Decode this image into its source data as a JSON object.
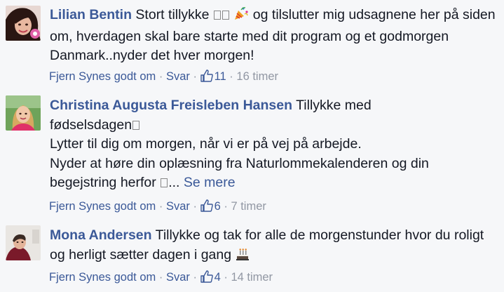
{
  "comments": [
    {
      "author": "Lilian Bentin",
      "text": "Stort tillykke",
      "text_after": "og tilslutter mig udsagnene her på siden om, hverdagen skal bare starte med dit program og et godmorgen Danmark..nyder det hver morgen!",
      "emoji": "party-popper-icon",
      "actions": {
        "remove": "Fjern Synes godt om",
        "reply": "Svar"
      },
      "likes": "11",
      "time": "16 timer"
    },
    {
      "author": "Christina Augusta Freisleben Hansen",
      "text_line1": "Tillykke med",
      "text_line2": "fødselsdagen",
      "text_line3": "Lytter til dig om morgen, når vi er på vej på arbejde.",
      "text_line4": "Nyder at høre din oplæsning fra Naturlommekalenderen og din",
      "text_line5": "begejstring herfor",
      "ellipsis": "...",
      "see_more": "Se mere",
      "actions": {
        "remove": "Fjern Synes godt om",
        "reply": "Svar"
      },
      "likes": "6",
      "time": "7 timer"
    },
    {
      "author": "Mona Andersen",
      "text": "Tillykke og tak for alle de morgenstunder hvor du roligt og herligt sætter dagen i gang",
      "emoji": "birthday-cake-icon",
      "actions": {
        "remove": "Fjern Synes godt om",
        "reply": "Svar"
      },
      "likes": "4",
      "time": "14 timer"
    }
  ],
  "separator": "·",
  "colors": {
    "author": "#3b5998",
    "meta": "#9197a3",
    "text": "#141823",
    "background": "#f6f7f9"
  }
}
